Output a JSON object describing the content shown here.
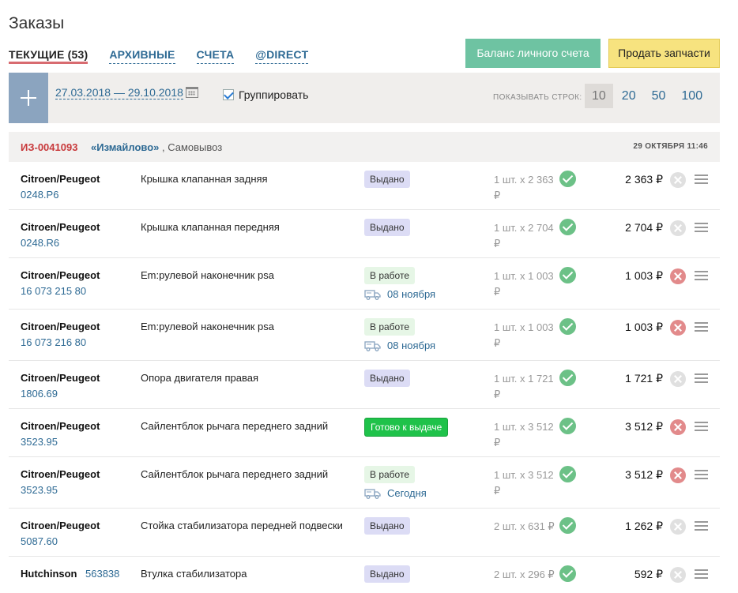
{
  "page": {
    "title": "Заказы"
  },
  "tabs": [
    {
      "label": "ТЕКУЩИЕ",
      "count": "(53)"
    },
    {
      "label": "АРХИВНЫЕ"
    },
    {
      "label": "СЧЕТА"
    },
    {
      "label": "@DIRECT"
    }
  ],
  "buttons": {
    "balance": "Баланс личного счета",
    "sell": "Продать запчасти"
  },
  "toolbar": {
    "daterange": "27.03.2018 — 29.10.2018",
    "group_label": "Группировать",
    "group_checked": true,
    "rows_label": "ПОКАЗЫВАТЬ СТРОК:",
    "rows_options": [
      "10",
      "20",
      "50",
      "100"
    ],
    "rows_selected": "10"
  },
  "order": {
    "id": "ИЗ-0041093",
    "store": "«Измайлово»",
    "pickup": ", Самовывоз",
    "date": "29 ОКТЯБРЯ 11:46"
  },
  "items": [
    {
      "brand": "Citroen/Peugeot",
      "partno": "0248.P6",
      "desc": "Крышка клапанная задняя",
      "status": "Выдано",
      "status_type": "issued",
      "eta": "",
      "qty": "1 шт. x 2 363 ₽",
      "sum": "2 363 ₽",
      "cancel_active": false
    },
    {
      "brand": "Citroen/Peugeot",
      "partno": "0248.R6",
      "desc": "Крышка клапанная передняя",
      "status": "Выдано",
      "status_type": "issued",
      "eta": "",
      "qty": "1 шт. x 2 704 ₽",
      "sum": "2 704 ₽",
      "cancel_active": false
    },
    {
      "brand": "Citroen/Peugeot",
      "partno": "16 073 215 80",
      "desc": "Em:рулевой наконечник psa",
      "status": "В работе",
      "status_type": "work",
      "eta": "08 ноября",
      "qty": "1 шт. x 1 003 ₽",
      "sum": "1 003 ₽",
      "cancel_active": true
    },
    {
      "brand": "Citroen/Peugeot",
      "partno": "16 073 216 80",
      "desc": "Em:рулевой наконечник psa",
      "status": "В работе",
      "status_type": "work",
      "eta": "08 ноября",
      "qty": "1 шт. x 1 003 ₽",
      "sum": "1 003 ₽",
      "cancel_active": true
    },
    {
      "brand": "Citroen/Peugeot",
      "partno": "1806.69",
      "desc": "Опора двигателя правая",
      "status": "Выдано",
      "status_type": "issued",
      "eta": "",
      "qty": "1 шт. x 1 721 ₽",
      "sum": "1 721 ₽",
      "cancel_active": false
    },
    {
      "brand": "Citroen/Peugeot",
      "partno": "3523.95",
      "desc": "Сайлентблок рычага переднего задний",
      "status": "Готово к выдаче",
      "status_type": "ready",
      "eta": "",
      "qty": "1 шт. x 3 512 ₽",
      "sum": "3 512 ₽",
      "cancel_active": true
    },
    {
      "brand": "Citroen/Peugeot",
      "partno": "3523.95",
      "desc": "Сайлентблок рычага переднего задний",
      "status": "В работе",
      "status_type": "work",
      "eta": "Сегодня",
      "qty": "1 шт. x 3 512 ₽",
      "sum": "3 512 ₽",
      "cancel_active": true
    },
    {
      "brand": "Citroen/Peugeot",
      "partno": "5087.60",
      "desc": "Стойка стабилизатора передней подвески",
      "status": "Выдано",
      "status_type": "issued",
      "eta": "",
      "qty": "2 шт. x 631 ₽",
      "sum": "1 262 ₽",
      "cancel_active": false
    },
    {
      "brand": "Hutchinson",
      "partno": "563838",
      "partno_inline": true,
      "desc": "Втулка стабилизатора",
      "status": "Выдано",
      "status_type": "issued",
      "eta": "",
      "qty": "2 шт. x 296 ₽",
      "sum": "592 ₽",
      "cancel_active": false
    }
  ]
}
